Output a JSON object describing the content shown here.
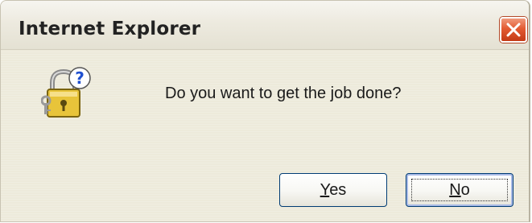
{
  "window": {
    "title": "Internet Explorer"
  },
  "dialog": {
    "message": "Do you want to get the job done?",
    "icon": "lock-question-icon",
    "buttons": {
      "yes": {
        "label_accel": "Y",
        "label_rest": "es"
      },
      "no": {
        "label_accel": "N",
        "label_rest": "o"
      }
    },
    "default_button": "no"
  },
  "colors": {
    "close_button": "#e35a32",
    "button_border": "#003c74",
    "lock_gold": "#e8c43a",
    "question_blue": "#1f4fd0"
  }
}
